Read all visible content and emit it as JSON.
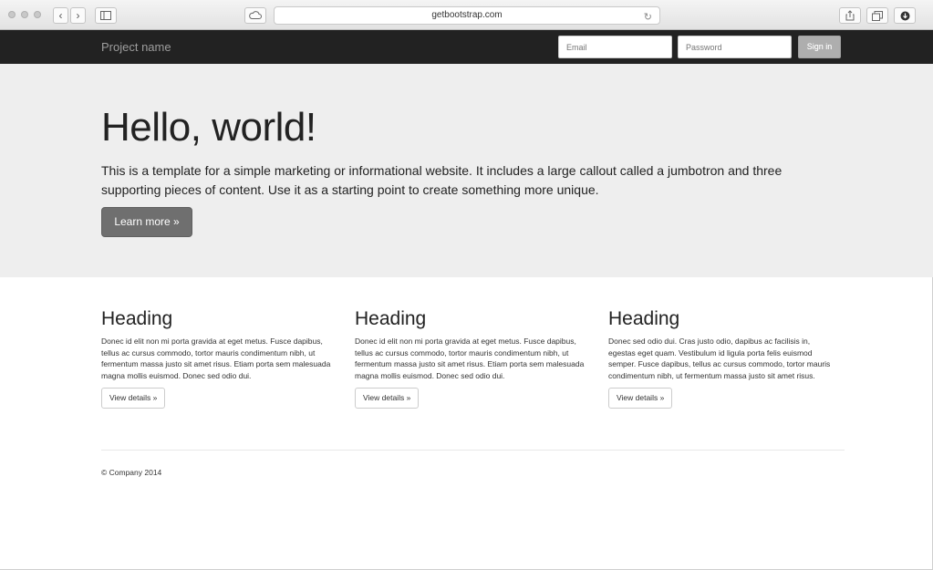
{
  "browser": {
    "url": "getbootstrap.com",
    "reload_icon": "reload-icon",
    "share_icon": "share-icon",
    "tabs_icon": "tabs-icon",
    "download_icon": "download-icon"
  },
  "navbar": {
    "brand": "Project name",
    "email_placeholder": "Email",
    "password_placeholder": "Password",
    "signin_label": "Sign in"
  },
  "jumbotron": {
    "title": "Hello, world!",
    "text": "This is a template for a simple marketing or informational website. It includes a large callout called a jumbotron and three supporting pieces of content. Use it as a starting point to create something more unique.",
    "button_label": "Learn more »"
  },
  "columns": [
    {
      "heading": "Heading",
      "text": "Donec id elit non mi porta gravida at eget metus. Fusce dapibus, tellus ac cursus commodo, tortor mauris condimentum nibh, ut fermentum massa justo sit amet risus. Etiam porta sem malesuada magna mollis euismod. Donec sed odio dui.",
      "button_label": "View details »"
    },
    {
      "heading": "Heading",
      "text": "Donec id elit non mi porta gravida at eget metus. Fusce dapibus, tellus ac cursus commodo, tortor mauris condimentum nibh, ut fermentum massa justo sit amet risus. Etiam porta sem malesuada magna mollis euismod. Donec sed odio dui.",
      "button_label": "View details »"
    },
    {
      "heading": "Heading",
      "text": "Donec sed odio dui. Cras justo odio, dapibus ac facilisis in, egestas eget quam. Vestibulum id ligula porta felis euismod semper. Fusce dapibus, tellus ac cursus commodo, tortor mauris condimentum nibh, ut fermentum massa justo sit amet risus.",
      "button_label": "View details »"
    }
  ],
  "footer": {
    "text": "© Company 2014"
  }
}
